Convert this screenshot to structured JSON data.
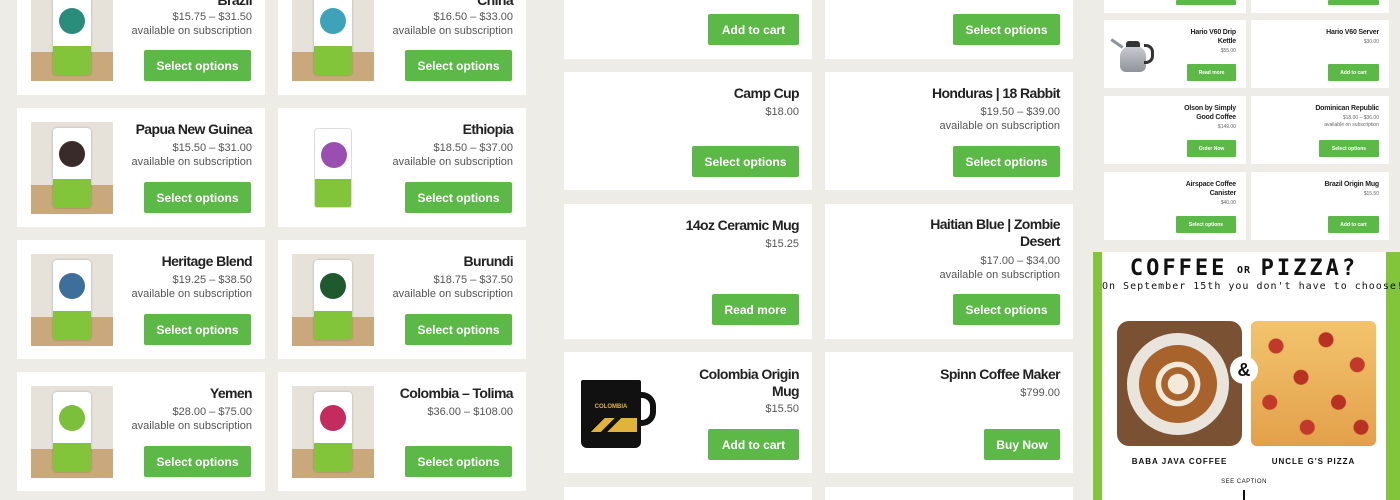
{
  "panel1": {
    "cards": [
      {
        "name": "Brazil",
        "price": "$15.75  –  $31.50",
        "sub": "available on subscription",
        "button": "Select options",
        "label_color": "#2a8c7a"
      },
      {
        "name": "China",
        "price": "$16.50  –  $33.00",
        "sub": "available on subscription",
        "button": "Select options",
        "label_color": "#3ea3b8"
      },
      {
        "name": "Papua New Guinea",
        "price": "$15.50  –  $31.00",
        "sub": "available on subscription",
        "button": "Select options",
        "label_color": "#3a2b2b"
      },
      {
        "name": "Ethiopia",
        "price": "$18.50  –  $37.00",
        "sub": "available on subscription",
        "button": "Select options",
        "label_color": "#9a4fb0"
      },
      {
        "name": "Heritage Blend",
        "price": "$19.25  –  $38.50",
        "sub": "available on subscription",
        "button": "Select options",
        "label_color": "#3d6f9a"
      },
      {
        "name": "Burundi",
        "price": "$18.75  –  $37.50",
        "sub": "available on subscription",
        "button": "Select options",
        "label_color": "#1f5a2e"
      },
      {
        "name": "Yemen",
        "price": "$28.00  –  $75.00",
        "sub": "available on subscription",
        "button": "Select options",
        "label_color": "#7cbf3a"
      },
      {
        "name": "Colombia – Tolima",
        "price": "$36.00  –  $108.00",
        "sub": "",
        "button": "Select options",
        "label_color": "#c42b5e"
      }
    ]
  },
  "panel2": {
    "top_buttons": [
      "Add to cart",
      "Select options"
    ],
    "cards": [
      {
        "name": "Camp Cup",
        "price": "$18.00",
        "sub": "",
        "button": "Select options"
      },
      {
        "name": "Honduras | 18 Rabbit",
        "price": "$19.50  –  $39.00",
        "sub": "available on subscription",
        "button": "Select options"
      },
      {
        "name": "14oz Ceramic Mug",
        "price": "$15.25",
        "sub": "",
        "button": "Read more"
      },
      {
        "name": "Haitian Blue | Zombie Desert",
        "price": "$17.00  –  $34.00",
        "sub": "available on subscription",
        "button": "Select options"
      },
      {
        "name": "Colombia Origin Mug",
        "price": "$15.50",
        "sub": "",
        "button": "Add to cart",
        "mug_text": "COLOMBIA"
      },
      {
        "name": "Spinn Coffee Maker",
        "price": "$799.00",
        "sub": "",
        "button": "Buy Now"
      }
    ]
  },
  "panel3": {
    "cards": [
      {
        "name": "Hario V60 Drip Kettle",
        "price": "$55.00",
        "button": "Read more"
      },
      {
        "name": "Hario V60 Server",
        "price": "$30.00",
        "button": "Add to cart"
      },
      {
        "name": "Olson by Simply Good Coffee",
        "price": "$149.00",
        "button": "Order Now"
      },
      {
        "name": "Dominican Republic",
        "price": "$18.00  –  $36.00",
        "sub": "available on subscription",
        "button": "Select options"
      },
      {
        "name": "Airspace Coffee Canister",
        "price": "$40.00",
        "button": "Select options"
      },
      {
        "name": "Brazil Origin Mug",
        "price": "$15.50",
        "button": "Add to cart"
      }
    ],
    "promo": {
      "title_left": "COFFEE",
      "title_or": "OR",
      "title_right": "PIZZA?",
      "subtitle": "On September 15th you don't have to choose!",
      "ampersand": "&",
      "left_caption": "BABA JAVA COFFEE",
      "right_caption": "UNCLE G'S PIZZA",
      "see_caption": "SEE CAPTION"
    }
  },
  "colors": {
    "accent_green": "#5cb947",
    "background": "#eeece6",
    "promo_green": "#82c53a"
  }
}
